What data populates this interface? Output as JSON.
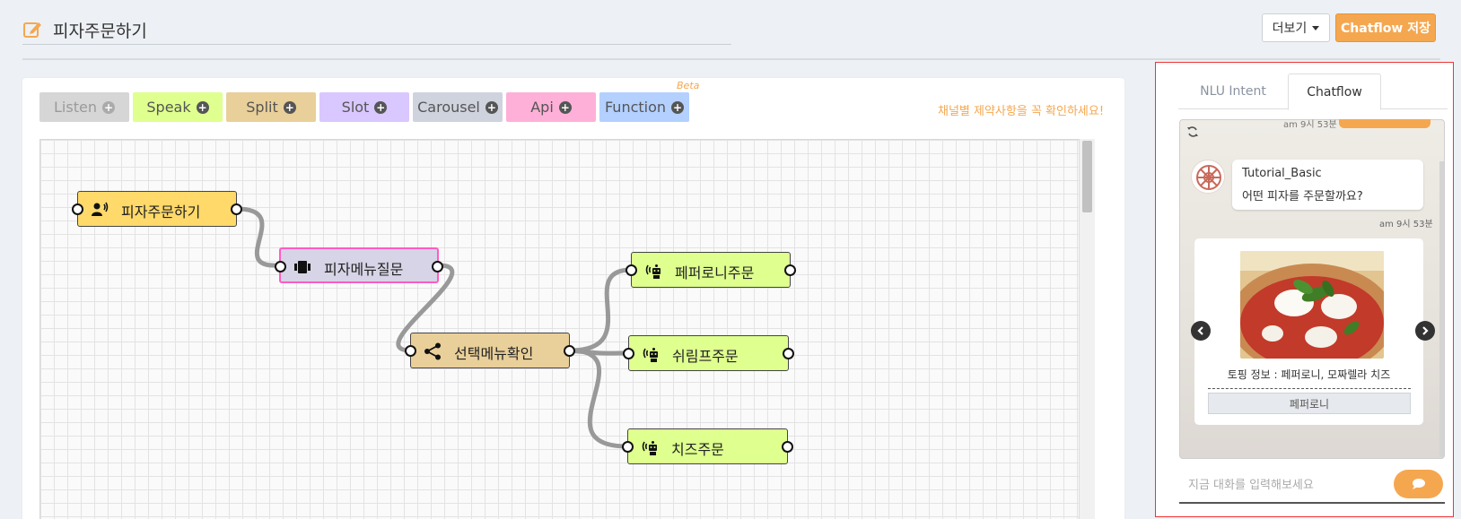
{
  "header": {
    "title": "피자주문하기",
    "more_label": "더보기",
    "save_label": "Chatflow 저장"
  },
  "toolbar": {
    "items": [
      {
        "label": "Listen"
      },
      {
        "label": "Speak"
      },
      {
        "label": "Split"
      },
      {
        "label": "Slot"
      },
      {
        "label": "Carousel"
      },
      {
        "label": "Api"
      },
      {
        "label": "Function"
      }
    ],
    "beta_label": "Beta",
    "notice": "채널별 제약사항을 꼭 확인하세요!"
  },
  "canvas": {
    "nodes": {
      "start": {
        "label": "피자주문하기",
        "type": "listen"
      },
      "question": {
        "label": "피자메뉴질문",
        "type": "carousel"
      },
      "split": {
        "label": "선택메뉴확인",
        "type": "split"
      },
      "pepperoni": {
        "label": "페퍼로니주문",
        "type": "speak"
      },
      "shrimp": {
        "label": "쉬림프주문",
        "type": "speak"
      },
      "cheese": {
        "label": "치즈주문",
        "type": "speak"
      }
    }
  },
  "panel": {
    "tabs": [
      {
        "label": "NLU Intent",
        "active": false
      },
      {
        "label": "Chatflow",
        "active": true
      }
    ],
    "chat": {
      "prev_time": "am 9시 53분",
      "bot_name": "Tutorial_Basic",
      "bot_message": "어떤 피자를 주문할까요?",
      "message_time": "am 9시 53분",
      "card": {
        "text": "토핑 정보 : 페퍼로니, 모짜렐라 치즈",
        "button_label": "페퍼로니"
      },
      "input_placeholder": "지금 대화를 입력해보세요"
    }
  },
  "colors": {
    "accent": "#f5a74f",
    "listen": "#ffd96a",
    "speak": "#dfff8f",
    "split": "#e9cf99",
    "slot": "#d9c7ff",
    "carousel": "#cfd3de",
    "api": "#ffb0d8",
    "function": "#b3d0ff",
    "selected_border": "#ff5cc0"
  }
}
